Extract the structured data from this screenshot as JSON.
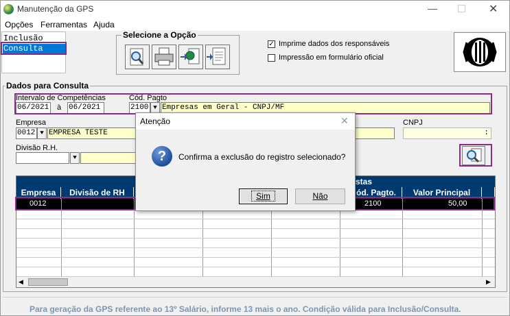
{
  "window": {
    "title": "Manutenção da GPS"
  },
  "menu": [
    "Opções",
    "Ferramentas",
    "Ajuda"
  ],
  "mode_list": [
    "Inclusão",
    "Consulta"
  ],
  "options": {
    "group_title": "Selecione a Opção",
    "print_responsibles": "Imprime dados dos responsáveis",
    "print_official_form": "Impressão em formulário oficial"
  },
  "query": {
    "group_title": "Dados para Consulta",
    "interval_label": "Intervalo de Competências",
    "interval_from": "06/2021",
    "interval_sep": "à",
    "interval_to": "06/2021",
    "payment_code_label": "Cód. Pagto",
    "payment_code": "2100",
    "payment_code_desc": "Empresas em Geral - CNPJ/MF",
    "company_label": "Empresa",
    "company_code": "0012",
    "company_name": "EMPRESA TESTE",
    "cnpj_label": "CNPJ",
    "cnpj_value": ":",
    "division_label": "Divisão R.H."
  },
  "grid": {
    "group_header": "stas",
    "columns": [
      "Empresa",
      "Divisão de RH",
      "",
      "",
      "",
      "ód. Pagto.",
      "Valor Principal"
    ],
    "selected_row": {
      "empresa": "0012",
      "cod_pagto": "2100",
      "valor": "50,00"
    }
  },
  "dialog": {
    "title": "Atenção",
    "message": "Confirma a exclusão do registro selecionado?",
    "yes": "Sim",
    "no": "Não"
  },
  "footer": "Para geração da GPS referente ao 13º Salário, informe 13 mais o ano. Condição válida para Inclusão/Consulta.",
  "colors": {
    "accent": "#8b2a8b",
    "grid_header": "#003a70",
    "selection": "#000000",
    "footer_text": "#7a96b4"
  }
}
